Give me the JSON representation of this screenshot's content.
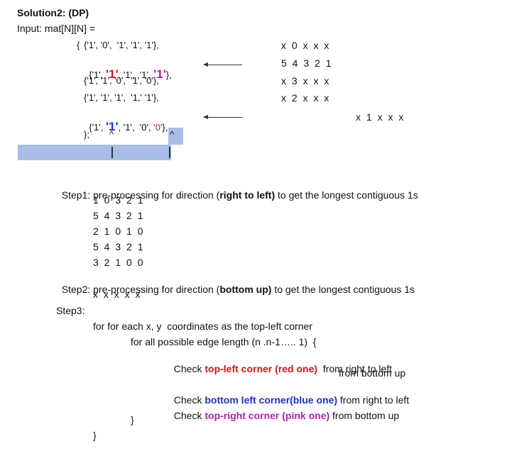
{
  "heading": "Solution2: (DP)",
  "input_label": "Input: mat[N][N] =",
  "matrix": {
    "open": "{",
    "rows": [
      {
        "pre": "{'1', '0',  '1', '1', '1'},",
        "hl": []
      },
      {
        "a": "{'1', ",
        "b": "'1'",
        "c": ", '1',  '1', ",
        "d": "'1'",
        "e": "},"
      },
      {
        "pre": "{'1', '1', '0',  '1', '0'},",
        "hl": []
      },
      {
        "pre": "{'1', '1', '1',  '1,' '1'},",
        "hl": []
      },
      {
        "a": "{'1', ",
        "b": "'1'",
        "c": ", '1',  '0', ",
        "d": "'0'",
        "e": "},"
      }
    ],
    "close": "};",
    "carets": [
      "^",
      "^"
    ]
  },
  "right_col": [
    "x 0 x x x",
    "5 4 3 2 1",
    "x 3 x x x",
    "x 2 x x x"
  ],
  "far_right": "x 1 x x x",
  "step1": {
    "prefix": "Step1: pre-processing for direction (",
    "bold": "right to left)",
    "suffix": " to get the longest contiguous 1s",
    "rows": [
      "1 0 3 2 1",
      "5 4 3 2 1",
      "2 1 0 1 0",
      "5 4 3 2 1",
      "3 2 1 0 0"
    ]
  },
  "step2": {
    "prefix": "Step2: pre-processing for direction (",
    "bold": "bottom up)",
    "suffix": " to get the longest contiguous 1s",
    "row": "x x x x x"
  },
  "step3": {
    "label": "Step3:",
    "line1": "for for each x, y  coordinates as the top-left corner",
    "line2": "for all possible edge length (n .n-1….. 1)  {",
    "check1_pre": "Check ",
    "check1_hl": "top-left corner (red one)",
    "check1_post": "  from right to left",
    "check1_post2": "from bottom up",
    "check2_pre": "Check ",
    "check2_hl": "bottom left corner(blue one)",
    "check2_post": " from right to left",
    "check3_pre": "Check ",
    "check3_hl": "top-right corner (pink one)",
    "check3_post": " from bottom up",
    "close_inner": "}",
    "close_outer": "}"
  },
  "colors": {
    "red": "#d01818",
    "blue": "#1a2fd0",
    "pink": "#b21fb2",
    "bar": "#a8bde8"
  }
}
